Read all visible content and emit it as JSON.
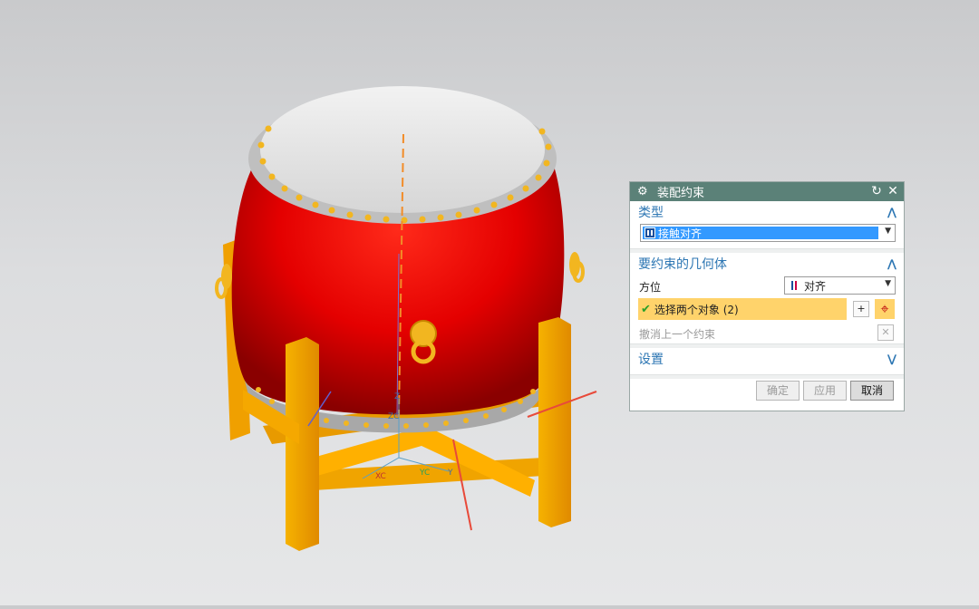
{
  "dialog": {
    "title": "装配约束",
    "reset_icon": "↻",
    "close_icon": "✕",
    "type_section": {
      "heading": "类型",
      "selected": "接触对齐",
      "collapse_icon": "chevron-up-icon"
    },
    "geometry_section": {
      "heading": "要约束的几何体",
      "orientation_label": "方位",
      "orientation_value": "对齐",
      "select_objects": "选择两个对象 (2)",
      "undo_last": "撤消上一个约束",
      "collapse_icon": "chevron-up-icon"
    },
    "settings_section": {
      "heading": "设置",
      "expand_icon": "chevron-down-icon"
    },
    "buttons": {
      "ok": "确定",
      "apply": "应用",
      "cancel": "取消"
    }
  },
  "viewport": {
    "axis_labels": {
      "z": "Z",
      "y": "Y",
      "zc": "ZC",
      "yc": "YC",
      "xc": "XC"
    },
    "colors": {
      "drum_body": "#e30000",
      "drum_head": "#e8e8e8",
      "stand": "#f5a800",
      "studs": "#f2b620"
    }
  }
}
